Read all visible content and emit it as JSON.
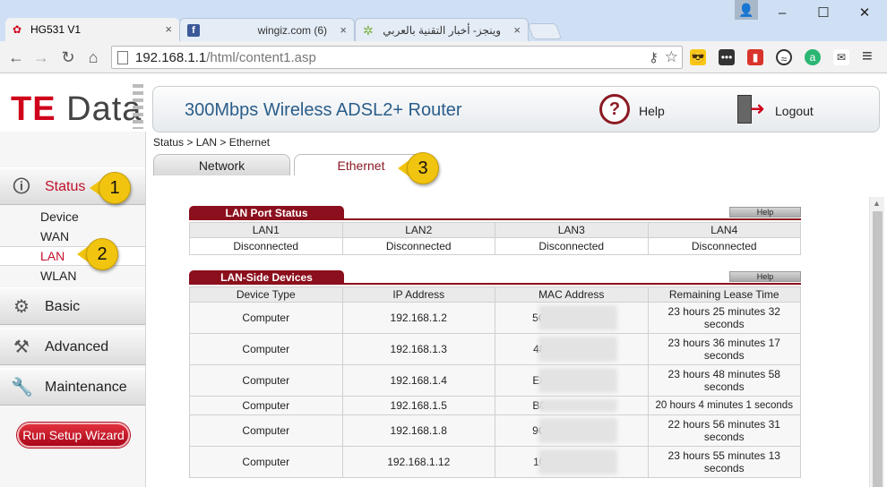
{
  "browser": {
    "tabs": [
      {
        "title": "HG531 V1",
        "close": "×"
      },
      {
        "title": "wingiz.com (6)",
        "close": "×"
      },
      {
        "title": "وينجز- أخبار التقنية بالعربي",
        "close": "×"
      }
    ],
    "favicon_fb": "f",
    "window": {
      "minimize": "–",
      "maximize": "☐",
      "close": "✕"
    },
    "user_icon": "👤",
    "nav": {
      "back": "←",
      "forward": "→",
      "reload": "↻",
      "home": "⌂"
    },
    "url_host": "192.168.1.1",
    "url_path": "/html/content1.asp",
    "key_icon": "⚷",
    "star_icon": "☆",
    "menu_icon": "≡"
  },
  "logo": {
    "prefix": "TE",
    "suffix": " Data"
  },
  "header": {
    "title": "300Mbps Wireless ADSL2+ Router",
    "help_icon": "?",
    "help": "Help",
    "logout": "Logout"
  },
  "sidebar": {
    "status": "Status",
    "status_items": [
      "Device",
      "WAN",
      "LAN",
      "WLAN"
    ],
    "basic": "Basic",
    "advanced": "Advanced",
    "maintenance": "Maintenance",
    "wizard": "Run Setup Wizard"
  },
  "breadcrumb": "Status > LAN > Ethernet",
  "subtabs": {
    "network": "Network",
    "ethernet": "Ethernet"
  },
  "lan_port_status": {
    "title": "LAN Port Status",
    "help": "Help",
    "headers": [
      "LAN1",
      "LAN2",
      "LAN3",
      "LAN4"
    ],
    "values": [
      "Disconnected",
      "Disconnected",
      "Disconnected",
      "Disconnected"
    ]
  },
  "lan_side_devices": {
    "title": "LAN-Side Devices",
    "help": "Help",
    "headers": [
      "Device Type",
      "IP Address",
      "MAC Address",
      "Remaining Lease Time"
    ],
    "rows": [
      {
        "type": "Computer",
        "ip": "192.168.1.2",
        "mac": "5C",
        "lease": "23 hours 25 minutes 32 seconds"
      },
      {
        "type": "Computer",
        "ip": "192.168.1.3",
        "mac": "48",
        "lease": "23 hours 36 minutes 17 seconds"
      },
      {
        "type": "Computer",
        "ip": "192.168.1.4",
        "mac": "E8",
        "lease": "23 hours 48 minutes 58 seconds"
      },
      {
        "type": "Computer",
        "ip": "192.168.1.5",
        "mac": "B0",
        "lease": "20 hours 4 minutes 1 seconds"
      },
      {
        "type": "Computer",
        "ip": "192.168.1.8",
        "mac": "9C",
        "lease": "22 hours 56 minutes 31 seconds"
      },
      {
        "type": "Computer",
        "ip": "192.168.1.12",
        "mac": "10",
        "lease": "23 hours 55 minutes 13 seconds"
      }
    ]
  },
  "annotations": [
    "1",
    "2",
    "3"
  ],
  "colors": {
    "brand_red": "#8b0f1c",
    "title_blue": "#2a5d8a",
    "badge_yellow": "#f1c40f"
  }
}
